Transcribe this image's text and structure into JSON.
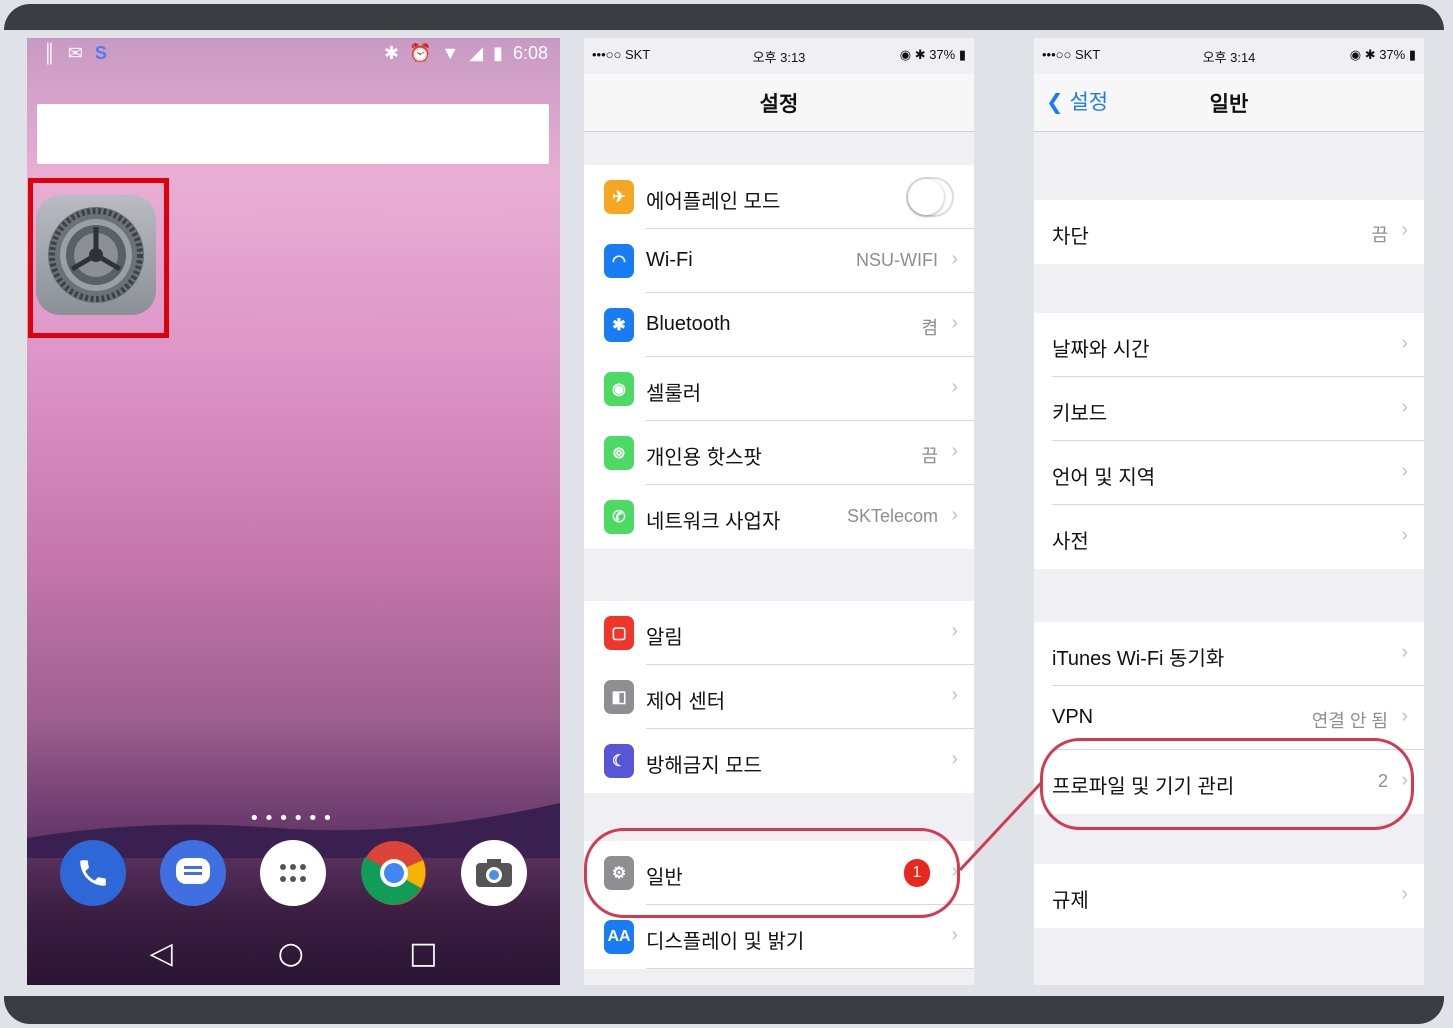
{
  "android": {
    "status_time": "6:08",
    "page_dots": "••••••",
    "dock": [
      "phone-app",
      "messages-app",
      "app-drawer",
      "chrome-app",
      "camera-app"
    ]
  },
  "ios_settings": {
    "carrier": "•••○○ SKT",
    "time": "오후 3:13",
    "battery": "37%",
    "title": "설정",
    "group1": [
      {
        "label": "에어플레인 모드",
        "value": "",
        "icon": "airplane-icon",
        "color": "#f5a623"
      },
      {
        "label": "Wi-Fi",
        "value": "NSU-WIFI",
        "icon": "wifi-icon",
        "color": "#1a7cf5"
      },
      {
        "label": "Bluetooth",
        "value": "켬",
        "icon": "bluetooth-icon",
        "color": "#1a7cf5"
      },
      {
        "label": "셀룰러",
        "value": "",
        "icon": "cellular-icon",
        "color": "#4cd964"
      },
      {
        "label": "개인용 핫스팟",
        "value": "끔",
        "icon": "hotspot-icon",
        "color": "#4cd964"
      },
      {
        "label": "네트워크 사업자",
        "value": "SKTelecom",
        "icon": "phone-icon",
        "color": "#4cd964"
      }
    ],
    "group2": [
      {
        "label": "알림",
        "value": "",
        "icon": "notification-icon",
        "color": "#f0352c"
      },
      {
        "label": "제어 센터",
        "value": "",
        "icon": "control-center-icon",
        "color": "#8e8e93"
      },
      {
        "label": "방해금지 모드",
        "value": "",
        "icon": "moon-icon",
        "color": "#5856d6"
      }
    ],
    "group3": [
      {
        "label": "일반",
        "badge": "1",
        "icon": "gear-icon",
        "color": "#8e8e93"
      },
      {
        "label": "디스플레이 및 밝기",
        "value": "",
        "icon": "display-icon",
        "color": "#1a7cf5"
      }
    ]
  },
  "ios_general": {
    "carrier": "•••○○ SKT",
    "time": "오후 3:14",
    "battery": "37%",
    "back_label": "설정",
    "title": "일반",
    "group1": [
      {
        "label": "차단",
        "value": "끔"
      }
    ],
    "group2": [
      {
        "label": "날짜와 시간",
        "value": ""
      },
      {
        "label": "키보드",
        "value": ""
      },
      {
        "label": "언어 및 지역",
        "value": ""
      },
      {
        "label": "사전",
        "value": ""
      }
    ],
    "group3": [
      {
        "label": "iTunes Wi-Fi 동기화",
        "value": ""
      },
      {
        "label": "VPN",
        "value": "연결 안 됨"
      },
      {
        "label": "프로파일 및 기기 관리",
        "value": "2"
      }
    ],
    "group4": [
      {
        "label": "규제",
        "value": ""
      }
    ]
  }
}
